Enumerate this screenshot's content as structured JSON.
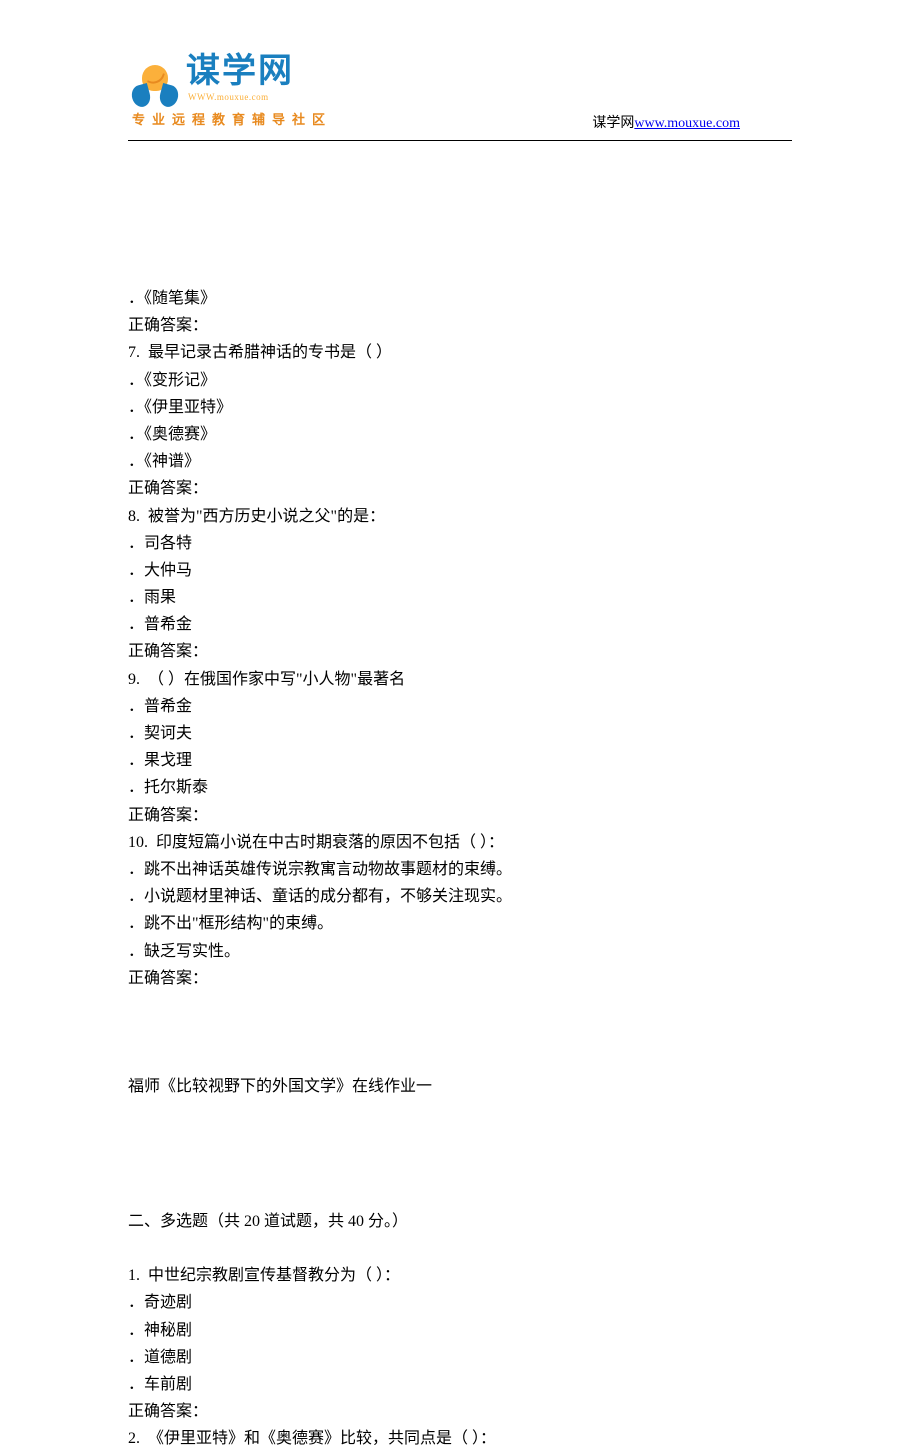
{
  "header": {
    "logo_main": "谋学网",
    "logo_url": "WWW.mouxue.com",
    "logo_subtitle": "专业远程教育辅导社区",
    "site_label": "谋学网",
    "site_link": "www.mouxue.com"
  },
  "body": {
    "lines": [
      "．《随笔集》",
      "正确答案：",
      "7.  最早记录古希腊神话的专书是（ ）",
      "．《变形记》",
      "．《伊里亚特》",
      "．《奥德赛》",
      "．《神谱》",
      "正确答案：",
      "8.  被誉为\"西方历史小说之父\"的是：",
      "．司各特",
      "．大仲马",
      "．雨果",
      "．普希金",
      "正确答案：",
      "9.  （ ）在俄国作家中写\"小人物\"最著名",
      "．普希金",
      "．契诃夫",
      "．果戈理",
      "．托尔斯泰",
      "正确答案：",
      "10.  印度短篇小说在中古时期衰落的原因不包括（ ）：",
      "．跳不出神话英雄传说宗教寓言动物故事题材的束缚。",
      "．小说题材里神话、童话的成分都有，不够关注现实。",
      "．跳不出\"框形结构\"的束缚。",
      "．缺乏写实性。",
      "正确答案："
    ],
    "section_title": "福师《比较视野下的外国文学》在线作业一",
    "part2_title": "二、多选题（共 20 道试题，共 40 分。）",
    "part2_lines": [
      "1.  中世纪宗教剧宣传基督教分为（ ）：",
      "．奇迹剧",
      "．神秘剧",
      "．道德剧",
      "．车前剧",
      "正确答案：",
      "2.  《伊里亚特》和《奥德赛》比较，共同点是（ ）："
    ]
  }
}
